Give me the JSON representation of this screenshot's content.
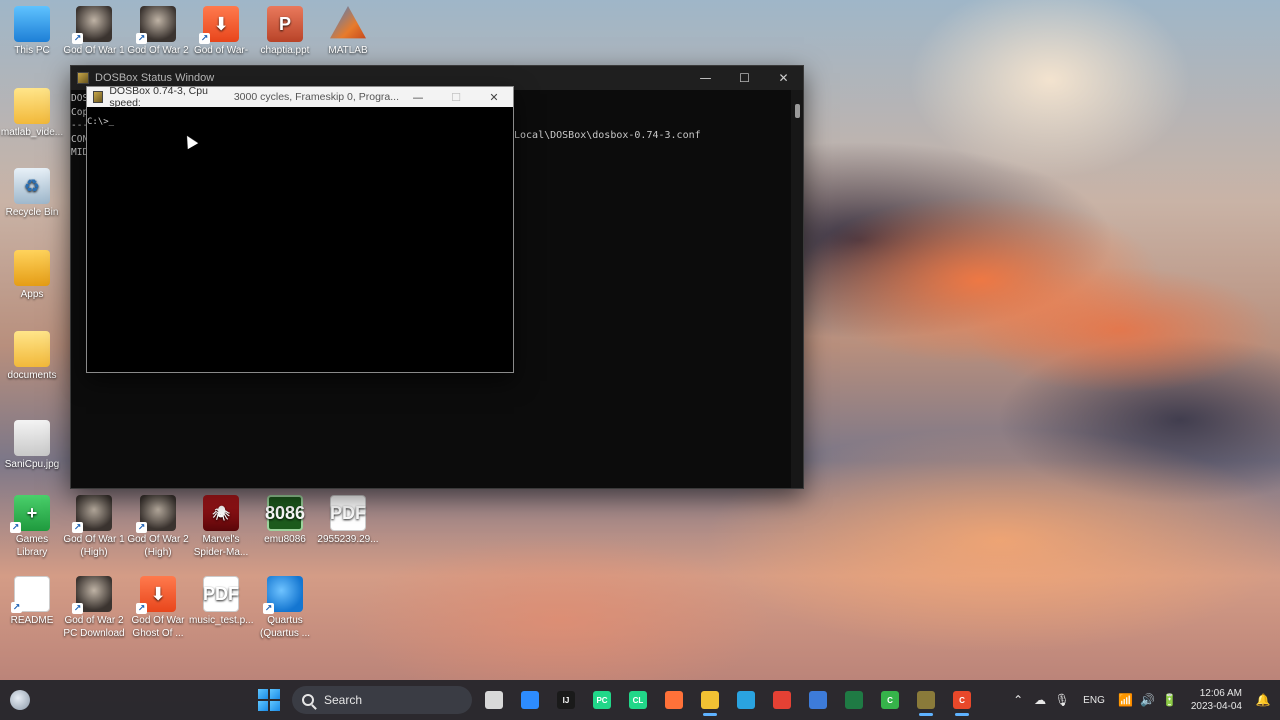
{
  "desktop_icons": [
    {
      "label": "This PC",
      "glyph": ""
    },
    {
      "label": "God Of War 1",
      "glyph": ""
    },
    {
      "label": "God Of War 2",
      "glyph": ""
    },
    {
      "label": "God of War-",
      "glyph": "⬇"
    },
    {
      "label": "chaptia.ppt",
      "glyph": "P"
    },
    {
      "label": "MATLAB",
      "glyph": ""
    },
    {
      "label": "matlab_vide...",
      "glyph": ""
    },
    {
      "label": "Recycle Bin",
      "glyph": "♻"
    },
    {
      "label": "Apps",
      "glyph": ""
    },
    {
      "label": "documents",
      "glyph": ""
    },
    {
      "label": "SaniCpu.jpg",
      "glyph": ""
    },
    {
      "label": "Games Library",
      "glyph": "+"
    },
    {
      "label": "God Of War 1 (High)",
      "glyph": ""
    },
    {
      "label": "God Of War 2 (High)",
      "glyph": ""
    },
    {
      "label": "Marvel's Spider-Ma...",
      "glyph": "🕷"
    },
    {
      "label": "emu8086",
      "glyph": "8086"
    },
    {
      "label": "2955239.29...",
      "glyph": "PDF"
    },
    {
      "label": "README",
      "glyph": ""
    },
    {
      "label": "God of War 2 PC Download",
      "glyph": ""
    },
    {
      "label": "God Of War Ghost Of ...",
      "glyph": "⬇"
    },
    {
      "label": "music_test.p...",
      "glyph": "PDF"
    },
    {
      "label": "Quartus (Quartus ...",
      "glyph": ""
    }
  ],
  "status_window": {
    "title": "DOSBox Status Window",
    "console_lines": [
      "DOS",
      "Cop",
      "---",
      "CON",
      "MID"
    ],
    "config_path": "Local\\DOSBox\\dosbox-0.74-3.conf"
  },
  "dosbox_window": {
    "title": "DOSBox 0.74-3, Cpu speed:",
    "title_status": "3000 cycles, Frameskip  0, Progra...",
    "prompt": "C:\\>_"
  },
  "window_controls": {
    "minimize": "—",
    "maximize": "☐",
    "close": "✕"
  },
  "taskbar": {
    "search_label": "Search",
    "apps": [
      {
        "name": "task-view",
        "text": "",
        "color": "#d8d8d8",
        "active": false
      },
      {
        "name": "zoom",
        "text": "",
        "color": "#2d8cff",
        "active": false
      },
      {
        "name": "intellij",
        "text": "IJ",
        "color": "#1a1a1a",
        "active": false
      },
      {
        "name": "pycharm",
        "text": "PC",
        "color": "#21d789",
        "active": false
      },
      {
        "name": "clion",
        "text": "CL",
        "color": "#21d789",
        "active": false
      },
      {
        "name": "firefox",
        "text": "",
        "color": "#ff7139",
        "active": false
      },
      {
        "name": "file-explorer",
        "text": "",
        "color": "#f2c233",
        "active": true
      },
      {
        "name": "telegram",
        "text": "",
        "color": "#2aa3e0",
        "active": false
      },
      {
        "name": "chrome",
        "text": "",
        "color": "#e44134",
        "active": false
      },
      {
        "name": "network-app",
        "text": "",
        "color": "#3d7bd9",
        "active": false
      },
      {
        "name": "excel",
        "text": "",
        "color": "#1f7a44",
        "active": false
      },
      {
        "name": "camtasia",
        "text": "C",
        "color": "#36b34a",
        "active": false
      },
      {
        "name": "dosbox",
        "text": "",
        "color": "#8a7a3a",
        "active": true
      },
      {
        "name": "recorder",
        "text": "C",
        "color": "#e8482a",
        "active": true
      }
    ]
  },
  "tray": {
    "language": "ENG",
    "time": "12:06 AM",
    "date": "2023-04-04"
  }
}
